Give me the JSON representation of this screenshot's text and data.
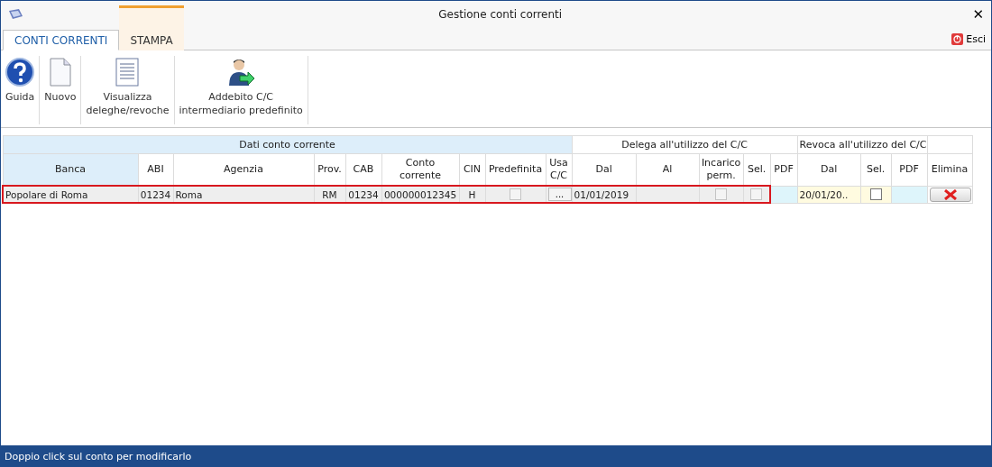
{
  "window": {
    "title": "Gestione conti correnti",
    "close": "✕"
  },
  "tabs": [
    {
      "label": "CONTI CORRENTI",
      "selected": true
    },
    {
      "label": "STAMPA",
      "selected": false
    }
  ],
  "exit": {
    "label": "Esci"
  },
  "toolbar": [
    {
      "kind": "help",
      "lines": [
        "Guida"
      ]
    },
    {
      "kind": "new",
      "lines": [
        "Nuovo"
      ]
    },
    {
      "kind": "list",
      "lines": [
        "Visualizza",
        "deleghe/revoche"
      ]
    },
    {
      "kind": "person",
      "lines": [
        "Addebito C/C",
        "intermediario predefinito"
      ]
    }
  ],
  "table": {
    "groups": [
      {
        "label": "Dati conto corrente",
        "kind": "data"
      },
      {
        "label": "Delega all'utilizzo del C/C",
        "kind": "plain"
      },
      {
        "label": "Revoca all'utilizzo del C/C",
        "kind": "plain"
      }
    ],
    "columns": [
      "Banca",
      "ABI",
      "Agenzia",
      "Prov.",
      "CAB",
      "Conto corrente",
      "CIN",
      "Predefinita",
      "Usa C/C",
      "Dal",
      "Al",
      "Incarico perm.",
      "Sel.",
      "PDF",
      "Dal",
      "Sel.",
      "PDF",
      "Elimina"
    ],
    "rows": [
      {
        "selected": true,
        "banca": "Popolare di Roma",
        "abi": "01234",
        "agenzia": "Roma",
        "prov": "RM",
        "cab": "01234",
        "conto": "000000012345",
        "cin": "H",
        "predefinita": false,
        "usa": "...",
        "delega_dal": "01/01/2019",
        "incarico": false,
        "delega_sel": false,
        "revoca_dal": "20/01/20..",
        "revoca_sel": false
      }
    ]
  },
  "status_bar": "Doppio click sul conto per modificarlo"
}
